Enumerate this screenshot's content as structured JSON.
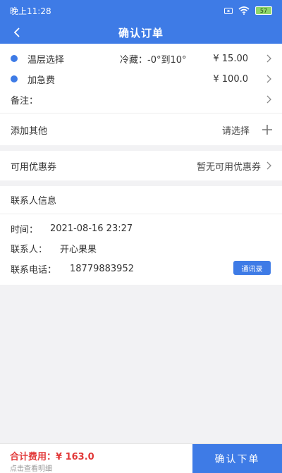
{
  "status_bar": {
    "time": "晚上11:28",
    "battery": "57"
  },
  "nav": {
    "title": "确认订单"
  },
  "items": [
    {
      "label": "温层选择",
      "detail": "冷藏：-0°到10°",
      "price": "¥ 15.00"
    },
    {
      "label": "加急费",
      "price": "¥ 100.0"
    }
  ],
  "remark": {
    "label": "备注："
  },
  "add_other": {
    "label": "添加其他",
    "value": "请选择"
  },
  "coupon": {
    "label": "可用优惠券",
    "value": "暂无可用优惠券"
  },
  "contact": {
    "header": "联系人信息",
    "time_label": "时间：",
    "time_value": "2021-08-16 23:27",
    "name_label": "联系人：",
    "name_value": "开心果果",
    "phone_label": "联系电话：",
    "phone_value": "18779883952",
    "address_book_button": "通讯录"
  },
  "footer": {
    "total_label": "合计费用：",
    "total_value": "¥ 163.0",
    "detail_link": "点击查看明细",
    "submit_button": "确认下单"
  },
  "colors": {
    "accent": "#3e7be6",
    "price_red": "#e23a3a"
  }
}
